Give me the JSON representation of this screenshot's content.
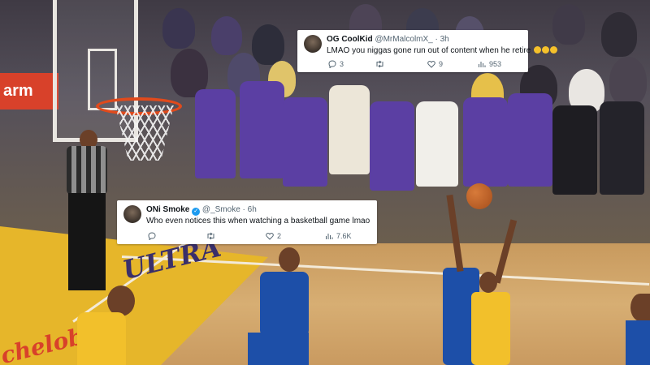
{
  "scene": {
    "ad_board_text": "arm",
    "court_text_ultra": "ULTRA",
    "court_text_side": "chelob"
  },
  "tweet_top": {
    "display_name": "OG CoolKid",
    "handle": "@MrMalcolmX_",
    "time": "· 3h",
    "text": "LMAO you niggas gone run out of content when he retire",
    "replies": "3",
    "retweets": "",
    "likes": "9",
    "views": "953",
    "icons": [
      "reply-icon",
      "retweet-icon",
      "heart-icon",
      "views-icon"
    ]
  },
  "tweet_bottom": {
    "display_name": "ONi Smoke",
    "handle": "@_Smoke",
    "time": "· 6h",
    "text": "Who even notices this when watching a basketball game lmao",
    "replies": "",
    "retweets": "",
    "likes": "2",
    "views": "7.6K",
    "icons": [
      "reply-icon",
      "retweet-icon",
      "heart-icon",
      "views-icon"
    ]
  },
  "colors": {
    "lakers_purple": "#5b3fa3",
    "lakers_gold": "#f2c02b",
    "warriors_blue": "#1d4fa8",
    "verified_blue": "#1d9bf0"
  }
}
